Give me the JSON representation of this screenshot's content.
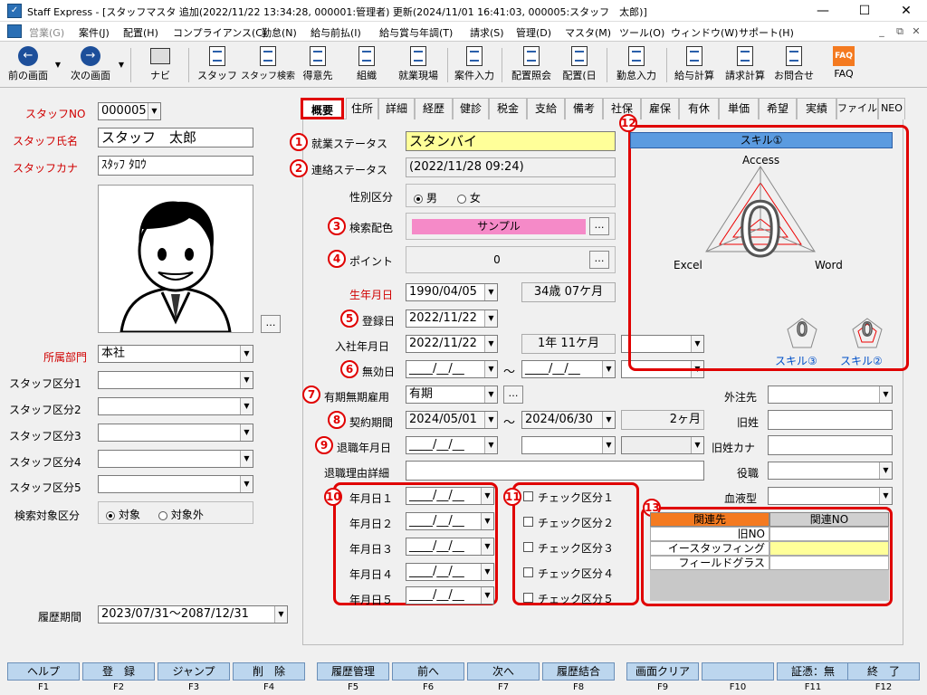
{
  "window": {
    "title": "Staff Express - [スタッフマスタ 追加(2022/11/22 13:34:28, 000001:管理者) 更新(2024/11/01 16:41:03, 000005:スタッフ　太郎)]",
    "min": "—",
    "max": "☐",
    "close": "✕",
    "mdi_min": "_",
    "mdi_max": "⧉",
    "mdi_close": "✕"
  },
  "menu": [
    "営業(G)",
    "案件(J)",
    "配置(H)",
    "コンプライアンス(C)",
    "勤怠(N)",
    "給与前払(I)",
    "給与賞与年調(T)",
    "請求(S)",
    "管理(D)",
    "マスタ(M)",
    "ツール(O)",
    "ウィンドウ(W)",
    "サポート(H)"
  ],
  "toolbar": {
    "back": "前の画面",
    "forward": "次の画面",
    "navi": "ナビ",
    "staff": "スタッフ",
    "staff_search": "スタッフ検索",
    "client": "得意先",
    "org": "組織",
    "site": "就業現場",
    "job_entry": "案件入力",
    "assign_inquiry": "配置照会",
    "assign_day": "配置(日",
    "attendance": "勤怠入力",
    "payroll": "給与計算",
    "billing": "請求計算",
    "contact": "お問合せ",
    "faq": "FAQ"
  },
  "left": {
    "staff_no_label": "スタッフNO",
    "staff_no": "000005",
    "name_label": "スタッフ氏名",
    "name": "スタッフ　太郎",
    "kana_label": "スタッフカナ",
    "kana": "ｽﾀｯﾌ ﾀﾛｳ",
    "dept_label": "所属部門",
    "dept": "本社",
    "cat1": "スタッフ区分1",
    "cat2": "スタッフ区分2",
    "cat3": "スタッフ区分3",
    "cat4": "スタッフ区分4",
    "cat5": "スタッフ区分5",
    "search_label": "検索対象区分",
    "search_on": "対象",
    "search_off": "対象外",
    "history_label": "履歴期間",
    "history": "2023/07/31～2087/12/31"
  },
  "tabs": [
    "概要",
    "住所",
    "詳細",
    "経歴",
    "健診",
    "税金",
    "支給",
    "備考",
    "社保",
    "雇保",
    "有休",
    "単価",
    "希望",
    "実績",
    "ファイル",
    "NEO"
  ],
  "form": {
    "work_status_label": "就業ステータス",
    "work_status": "スタンバイ",
    "contact_status_label": "連絡ステータス",
    "contact_status": "(2022/11/28 09:24)",
    "gender_label": "性別区分",
    "male": "男",
    "female": "女",
    "color_label": "検索配色",
    "color_sample": "サンプル",
    "point_label": "ポイント",
    "point": "0",
    "birth_label": "生年月日",
    "birth": "1990/04/05",
    "age": "34歳 07ケ月",
    "reg_label": "登録日",
    "reg": "2022/11/22",
    "join_label": "入社年月日",
    "join": "2022/11/22",
    "tenure": "1年 11ケ月",
    "invalid_label": "無効日",
    "blank_date": "____/__/__",
    "tilde": "～",
    "emp_label": "有期無期雇用",
    "emp": "有期",
    "contract_label": "契約期間",
    "contract_from": "2024/05/01",
    "contract_to": "2024/06/30",
    "contract_len": "2ヶ月",
    "retire_label": "退職年月日",
    "retire_reason_label": "退職理由詳細",
    "outsource_label": "外注先",
    "old_name_label": "旧姓",
    "old_kana_label": "旧姓カナ",
    "post_label": "役職",
    "blood_label": "血液型",
    "date1": "年月日１",
    "date2": "年月日２",
    "date3": "年月日３",
    "date4": "年月日４",
    "date5": "年月日５",
    "chk1": "チェック区分１",
    "chk2": "チェック区分２",
    "chk3": "チェック区分３",
    "chk4": "チェック区分４",
    "chk5": "チェック区分５"
  },
  "skill": {
    "title": "スキル①",
    "access": "Access",
    "excel": "Excel",
    "word": "Word",
    "big_value": "0",
    "small_value1": "0",
    "small_value2": "0",
    "skill3": "スキル③",
    "skill2": "スキル②"
  },
  "related": {
    "h1": "関連先",
    "h2": "関連NO",
    "rows": [
      "旧NO",
      "イースタッフィング",
      "フィールドグラス"
    ]
  },
  "numbers": [
    "1",
    "2",
    "3",
    "4",
    "5",
    "6",
    "7",
    "8",
    "9",
    "10",
    "11",
    "12",
    "13"
  ],
  "fkeys": [
    {
      "label": "ヘルプ",
      "key": "F1"
    },
    {
      "label": "登　録",
      "key": "F2"
    },
    {
      "label": "ジャンプ",
      "key": "F3"
    },
    {
      "label": "削　除",
      "key": "F4"
    },
    {
      "label": "履歴管理",
      "key": "F5"
    },
    {
      "label": "前へ",
      "key": "F6"
    },
    {
      "label": "次へ",
      "key": "F7"
    },
    {
      "label": "履歴結合",
      "key": "F8"
    },
    {
      "label": "画面クリア",
      "key": "F9"
    },
    {
      "label": "",
      "key": "F10"
    },
    {
      "label": "証憑：無",
      "key": "F11"
    },
    {
      "label": "終　了",
      "key": "F12"
    }
  ]
}
